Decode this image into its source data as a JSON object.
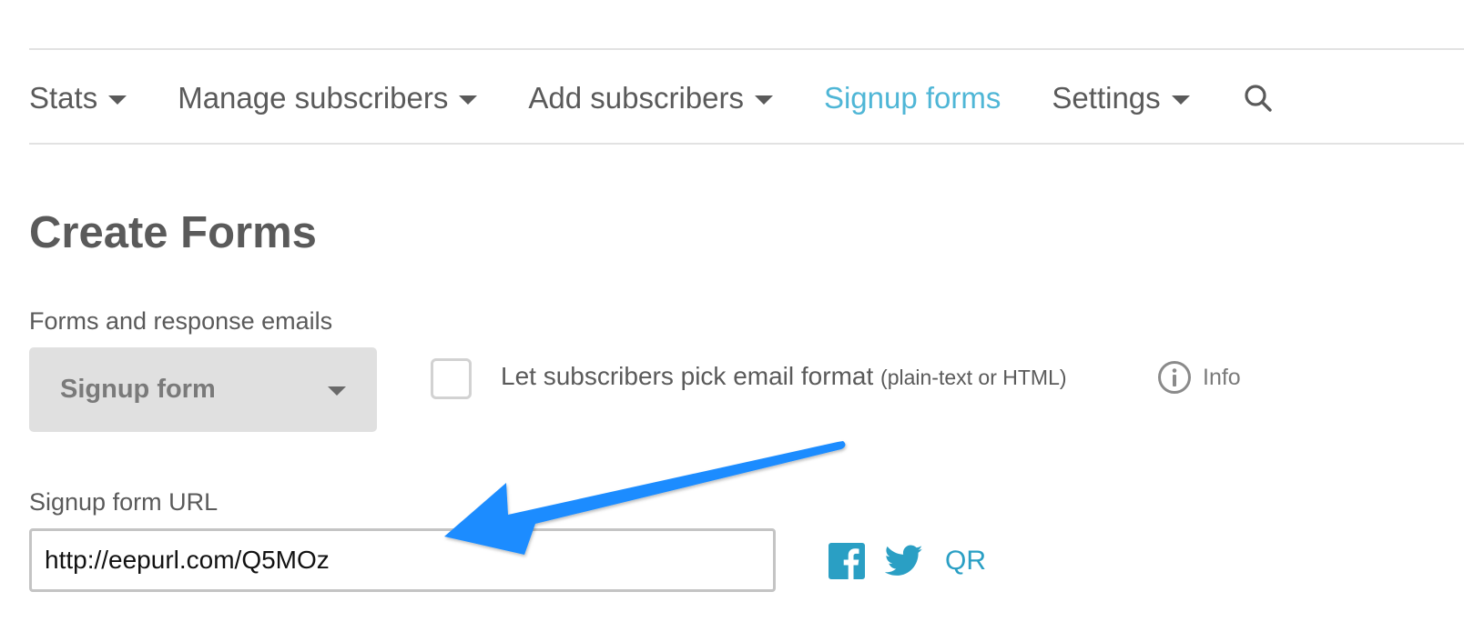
{
  "nav": {
    "items": [
      {
        "label": "Stats",
        "has_dropdown": true,
        "active": false
      },
      {
        "label": "Manage subscribers",
        "has_dropdown": true,
        "active": false
      },
      {
        "label": "Add subscribers",
        "has_dropdown": true,
        "active": false
      },
      {
        "label": "Signup forms",
        "has_dropdown": false,
        "active": true
      },
      {
        "label": "Settings",
        "has_dropdown": true,
        "active": false
      }
    ],
    "search_icon": "search-icon",
    "active_color": "#4fb6d6"
  },
  "page": {
    "title": "Create Forms"
  },
  "forms_select": {
    "label": "Forms and response emails",
    "value": "Signup form"
  },
  "format_option": {
    "checked": false,
    "label": "Let subscribers pick email format",
    "hint": "(plain-text or HTML)"
  },
  "info": {
    "icon": "info-icon",
    "label": "Info"
  },
  "url_field": {
    "label": "Signup form URL",
    "value": "http://eepurl.com/Q5MOz"
  },
  "share": {
    "facebook_icon": "facebook-icon",
    "twitter_icon": "twitter-icon",
    "qr_label": "QR",
    "color": "#2a9fc4"
  },
  "annotation": {
    "type": "arrow",
    "color": "#1a8cff",
    "points_to": "url_field"
  }
}
